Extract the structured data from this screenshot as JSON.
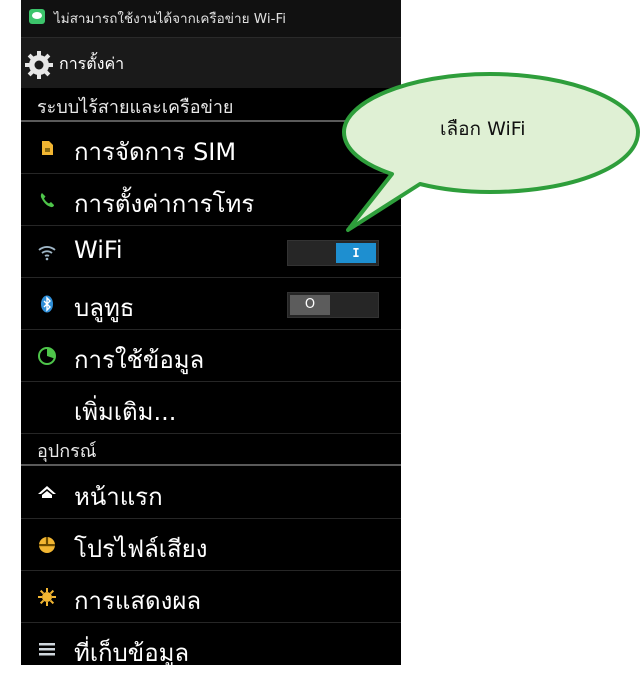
{
  "status_bar": {
    "notification_text": "ไม่สามารถใช้งานได้จากเครือข่าย Wi-Fi"
  },
  "action_bar": {
    "title": "การตั้งค่า",
    "icon": "gear-icon"
  },
  "sections": {
    "wireless": "ระบบไร้สายและเครือข่าย",
    "device": "อุปกรณ์"
  },
  "items": {
    "sim": {
      "label": "การจัดการ SIM",
      "icon": "sim-card-icon",
      "icon_color": "#f2b632"
    },
    "call": {
      "label": "การตั้งค่าการโทร",
      "icon": "phone-icon",
      "icon_color": "#4ec54a"
    },
    "wifi": {
      "label": "WiFi",
      "icon": "wifi-icon",
      "icon_color": "#9fb6c6",
      "toggle_state": "on",
      "toggle_glyph": "I"
    },
    "bluetooth": {
      "label": "บลูทูธ",
      "icon": "bluetooth-icon",
      "icon_color": "#2f8fd8",
      "toggle_state": "off",
      "toggle_glyph": "O"
    },
    "data": {
      "label": "การใช้ข้อมูล",
      "icon": "data-usage-icon",
      "icon_color": "#4ec54a"
    },
    "more": {
      "label": "เพิ่มเติม..."
    },
    "home": {
      "label": "หน้าแรก",
      "icon": "home-icon",
      "icon_color": "#ffffff"
    },
    "sound": {
      "label": "โปรไฟล์เสียง",
      "icon": "sound-profile-icon",
      "icon_color": "#f2b632"
    },
    "display": {
      "label": "การแสดงผล",
      "icon": "brightness-icon",
      "icon_color": "#f2b632"
    },
    "storage": {
      "label": "ที่เก็บข้อมูล",
      "icon": "storage-icon",
      "icon_color": "#cfd6dc"
    }
  },
  "callout": {
    "text": "เลือก WiFi",
    "fill": "#dff0d4",
    "stroke": "#2e9e3b"
  },
  "colors": {
    "toggle_on": "#1e8fd0",
    "toggle_off": "#5c5c5c"
  }
}
